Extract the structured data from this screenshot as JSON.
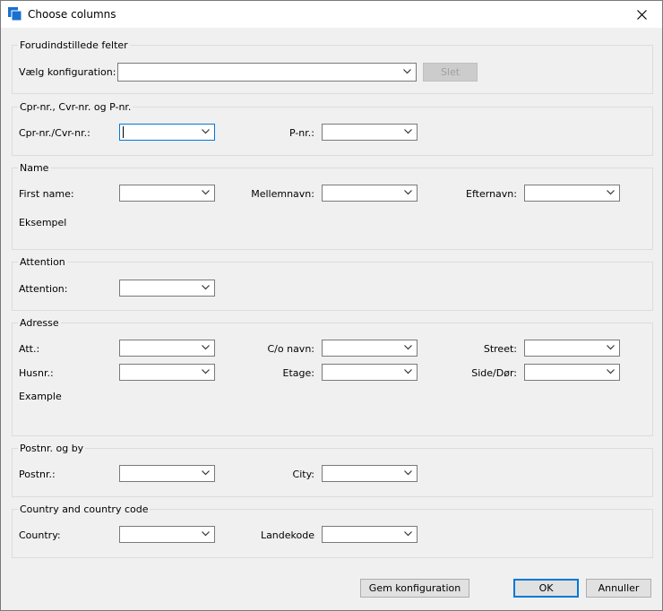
{
  "window": {
    "title": "Choose columns"
  },
  "groups": {
    "presets": {
      "legend": "Forudindstillede felter",
      "label": "Vælg konfiguration:",
      "value": "",
      "delete_label": "Slet"
    },
    "cpr": {
      "legend": "Cpr-nr., Cvr-nr. og P-nr.",
      "cpr_label": "Cpr-nr./Cvr-nr.:",
      "pnr_label": "P-nr.:"
    },
    "name": {
      "legend": "Name",
      "first_label": "First name:",
      "middle_label": "Mellemnavn:",
      "last_label": "Efternavn:",
      "example": "Eksempel"
    },
    "attention": {
      "legend": "Attention",
      "label": "Attention:"
    },
    "address": {
      "legend": "Adresse",
      "att_label": "Att.:",
      "co_label": "C/o navn:",
      "street_label": "Street:",
      "husnr_label": "Husnr.:",
      "etage_label": "Etage:",
      "side_label": "Side/Dør:",
      "example": "Example"
    },
    "postal": {
      "legend": "Postnr. og by",
      "postnr_label": "Postnr.:",
      "city_label": "City:"
    },
    "country": {
      "legend": "Country and country code",
      "country_label": "Country:",
      "code_label": "Landekode"
    }
  },
  "buttons": {
    "save_config": "Gem konfiguration",
    "ok": "OK",
    "cancel": "Annuller"
  },
  "colors": {
    "accent": "#0078d7",
    "app_icon": "#1a6fd1"
  }
}
